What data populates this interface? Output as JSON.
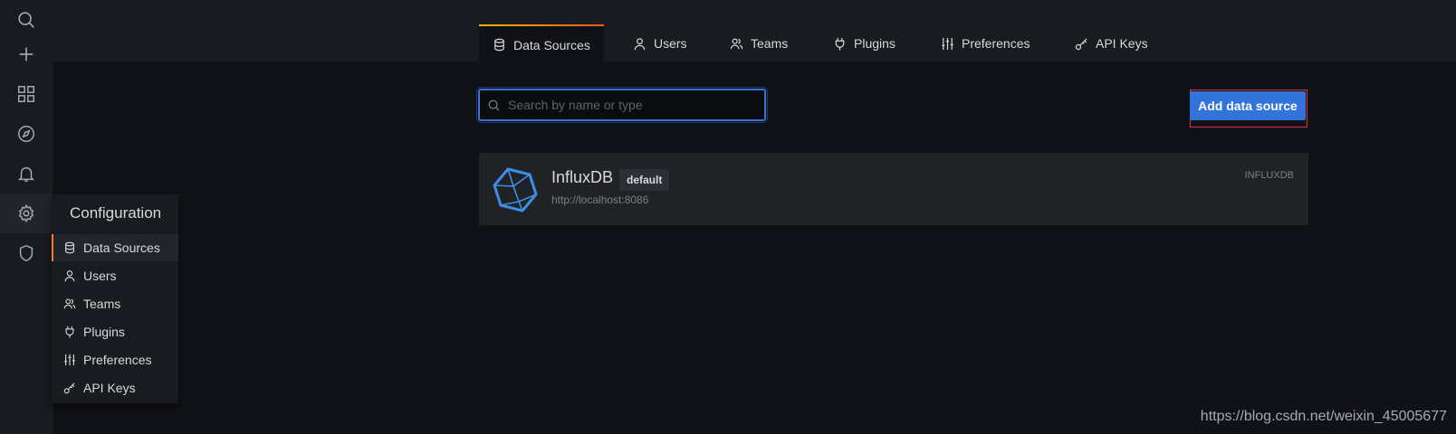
{
  "sidemenu": {
    "items": [
      {
        "icon": "search-icon"
      },
      {
        "icon": "plus-icon"
      },
      {
        "icon": "dashboards-icon"
      },
      {
        "icon": "compass-icon"
      },
      {
        "icon": "bell-icon"
      },
      {
        "icon": "gear-icon"
      },
      {
        "icon": "shield-icon"
      }
    ]
  },
  "tabs": [
    {
      "label": "Data Sources",
      "icon": "database-icon",
      "active": true
    },
    {
      "label": "Users",
      "icon": "user-icon"
    },
    {
      "label": "Teams",
      "icon": "users-icon"
    },
    {
      "label": "Plugins",
      "icon": "plug-icon"
    },
    {
      "label": "Preferences",
      "icon": "sliders-icon"
    },
    {
      "label": "API Keys",
      "icon": "key-icon"
    }
  ],
  "search": {
    "placeholder": "Search by name or type",
    "value": ""
  },
  "add_button": {
    "label": "Add data source"
  },
  "datasources": [
    {
      "name": "InfluxDB",
      "badge": "default",
      "url": "http://localhost:8086",
      "type": "INFLUXDB"
    }
  ],
  "flyout": {
    "title": "Configuration",
    "items": [
      {
        "label": "Data Sources",
        "icon": "database-icon",
        "active": true
      },
      {
        "label": "Users",
        "icon": "user-icon"
      },
      {
        "label": "Teams",
        "icon": "users-icon"
      },
      {
        "label": "Plugins",
        "icon": "plug-icon"
      },
      {
        "label": "Preferences",
        "icon": "sliders-icon"
      },
      {
        "label": "API Keys",
        "icon": "key-icon"
      }
    ]
  },
  "watermark": "https://blog.csdn.net/weixin_45005677",
  "colors": {
    "accent": "#3274d9",
    "highlight_frame": "#e02f44",
    "active_tab_gradient_start": "#f7b500",
    "active_tab_gradient_end": "#ff5722",
    "influx_logo": "#3d8fe6"
  }
}
